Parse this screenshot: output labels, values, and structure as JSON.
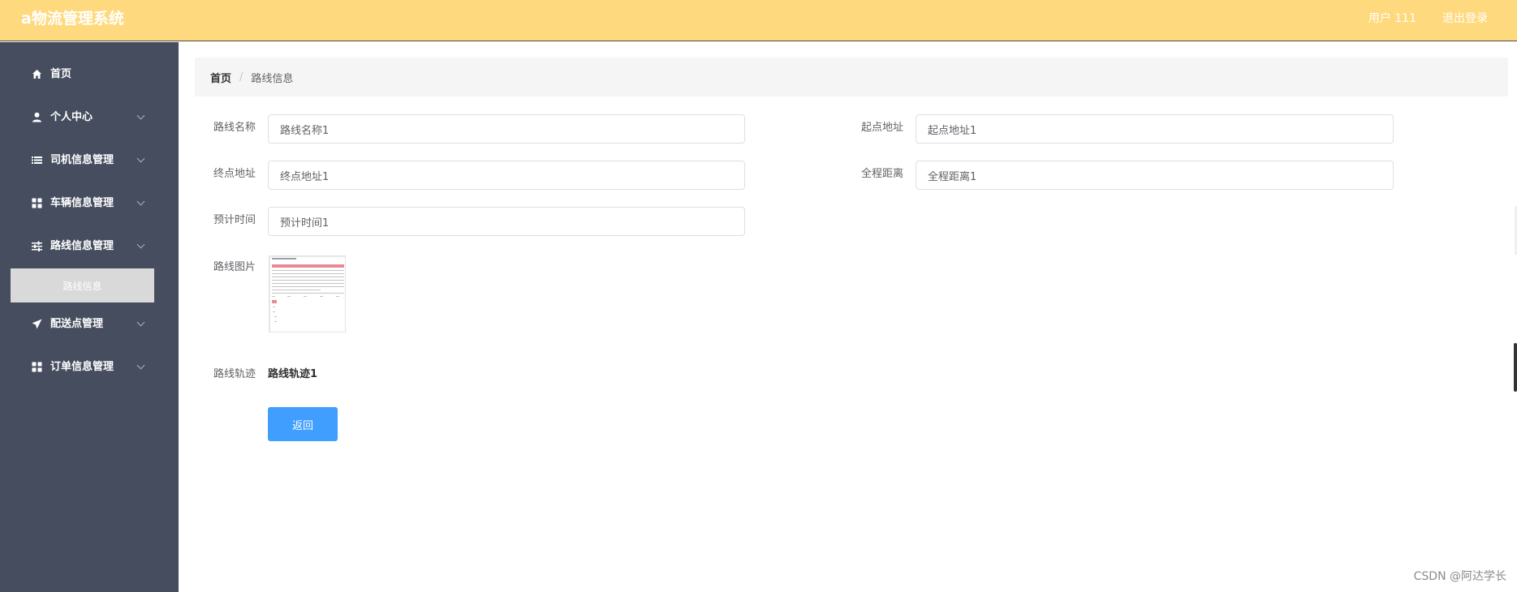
{
  "app": {
    "title": "a物流管理系统"
  },
  "header": {
    "user": "用户 111",
    "logout": "退出登录"
  },
  "sidebar": {
    "items": [
      {
        "label": "首页",
        "icon": "home-icon"
      },
      {
        "label": "个人中心",
        "icon": "user-icon"
      },
      {
        "label": "司机信息管理",
        "icon": "list-icon"
      },
      {
        "label": "车辆信息管理",
        "icon": "grid-icon"
      },
      {
        "label": "路线信息管理",
        "icon": "sliders-icon"
      },
      {
        "label": "配送点管理",
        "icon": "send-icon"
      },
      {
        "label": "订单信息管理",
        "icon": "grid-icon"
      }
    ],
    "active_sub": "路线信息"
  },
  "breadcrumb": {
    "home": "首页",
    "separator": "/",
    "current": "路线信息"
  },
  "form": {
    "route_name_label": "路线名称",
    "route_name_value": "路线名称1",
    "start_label": "起点地址",
    "start_value": "起点地址1",
    "end_label": "终点地址",
    "end_value": "终点地址1",
    "distance_label": "全程距离",
    "distance_value": "全程距离1",
    "time_label": "预计时间",
    "time_value": "预计时间1",
    "image_label": "路线图片",
    "track_label": "路线轨迹",
    "track_value": "路线轨迹1"
  },
  "buttons": {
    "back": "返回"
  },
  "watermark": "CSDN @阿达学长",
  "colors": {
    "header": "#ffd97d",
    "sidebar": "#454d5e",
    "primary": "#409eff"
  }
}
